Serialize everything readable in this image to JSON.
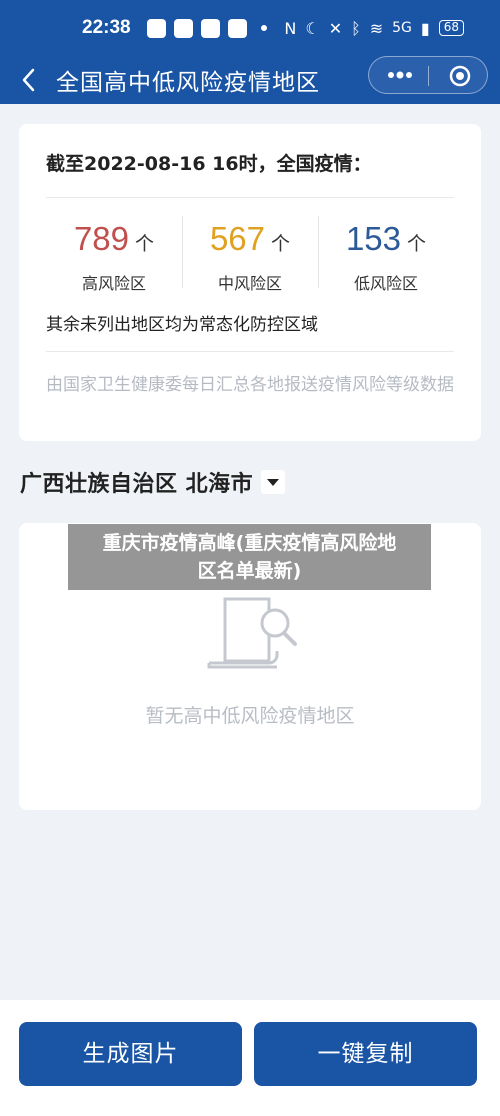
{
  "status": {
    "time": "22:38",
    "network": "5G",
    "battery": "68"
  },
  "nav": {
    "title": "全国高中低风险疫情地区",
    "icons": [
      "back-icon",
      "more-icon",
      "target-icon"
    ]
  },
  "summary": {
    "deadline": "截至2022-08-16 16时，全国疫情：",
    "stats": [
      {
        "value": "789",
        "unit": "个",
        "label": "高风险区",
        "color": "#c0504d"
      },
      {
        "value": "567",
        "unit": "个",
        "label": "中风险区",
        "color": "#e0a020"
      },
      {
        "value": "153",
        "unit": "个",
        "label": "低风险区",
        "color": "#2c5a99"
      }
    ],
    "rest_note": "其余未列出地区均为常态化防控区域",
    "source_note": "由国家卫生健康委每日汇总各地报送疫情风险等级数据"
  },
  "region": {
    "selected": "广西壮族自治区 北海市"
  },
  "empty_state": {
    "text": "暂无高中低风险疫情地区"
  },
  "overlay": {
    "line1": "重庆市疫情高峰(重庆疫情高风险地",
    "line2": "区名单最新)"
  },
  "actions": {
    "generate_image": "生成图片",
    "copy_all": "一键复制"
  },
  "colors": {
    "brand": "#1a54a5",
    "background": "#eff2f7"
  }
}
